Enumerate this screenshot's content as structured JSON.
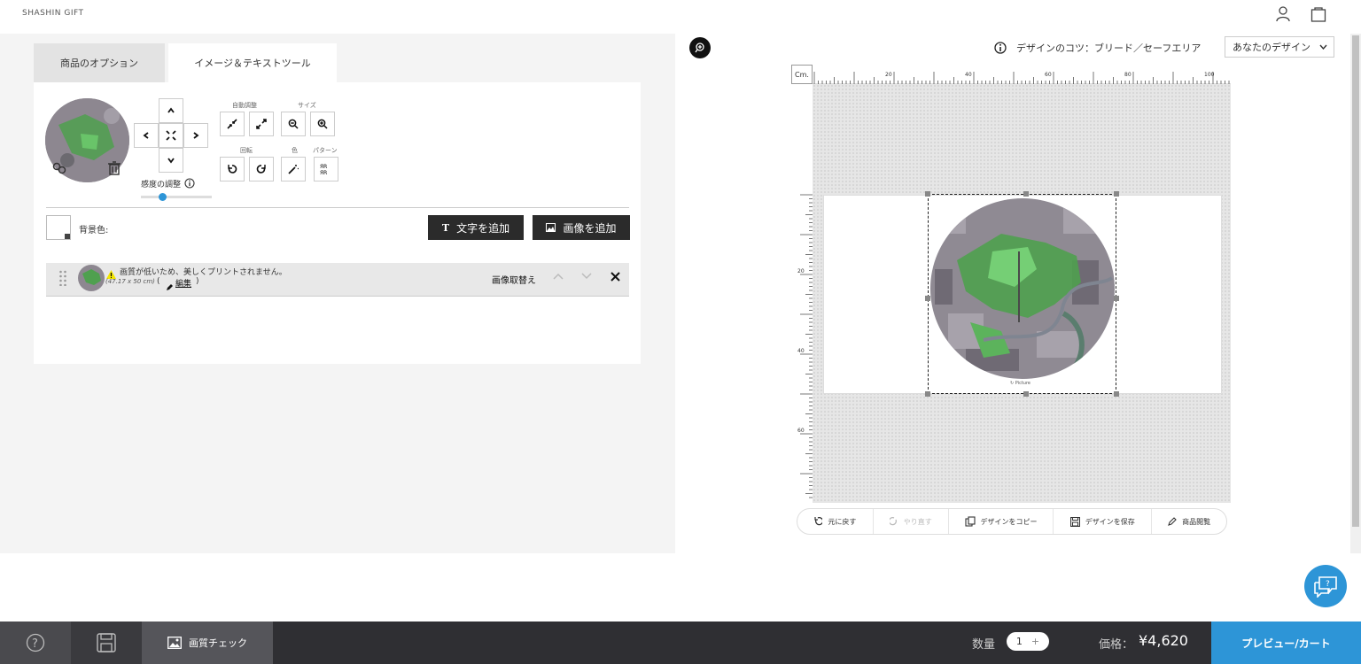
{
  "header": {
    "brand": "SHASHIN GIFT"
  },
  "tabs": [
    {
      "label": "商品のオプション",
      "active": false
    },
    {
      "label": "イメージ＆テキストツール",
      "active": true
    }
  ],
  "tools": {
    "auto_adjust_label": "自動調整",
    "size_label": "サイズ",
    "rotate_label": "回転",
    "color_label": "色",
    "pattern_label": "パターン",
    "sensitivity_label": "感度の調整",
    "sensitivity_value": 0.3
  },
  "background": {
    "label": "背景色:"
  },
  "actions": {
    "add_text": "文字を追加",
    "add_image": "画像を追加"
  },
  "layer": {
    "warning": "画質が低いため、美しくプリントされません。",
    "dims": "(47.17 x 50 cm)",
    "edit_open": "(",
    "edit_label": "編集",
    "edit_close": ")",
    "replace_label": "画像取替え"
  },
  "canvas": {
    "tips_label": "デザインのコツ：ブリード／セーフエリア",
    "design_select": "あなたのデザイン",
    "ruler_unit": "Cm.",
    "ruler_top": [
      "20",
      "40",
      "60",
      "80",
      "100"
    ],
    "ruler_left": [
      "20",
      "40",
      "60"
    ],
    "watermark": "Picture"
  },
  "toolbar": {
    "undo": "元に戻す",
    "redo": "やり直す",
    "copy": "デザインをコピー",
    "save": "デザインを保存",
    "view": "商品閲覧"
  },
  "footer": {
    "quality_check": "画質チェック",
    "qty_label": "数量",
    "qty_value": "1",
    "qty_plus": "+",
    "price_label": "価格：",
    "price_value": "¥4,620",
    "cart_button": "プレビュー/カート"
  },
  "colors": {
    "accent": "#2d95d7",
    "dark": "#2f2f33",
    "cart": "#2d95d7"
  }
}
